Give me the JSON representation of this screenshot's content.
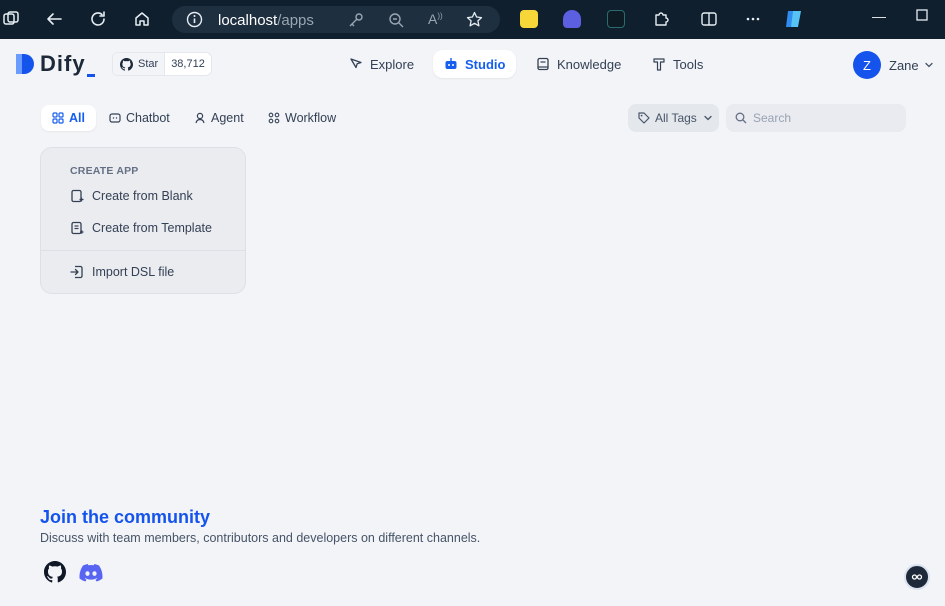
{
  "browser": {
    "url_host": "localhost",
    "url_path": "/apps"
  },
  "header": {
    "logo_text": "Dify",
    "github_star_label": "Star",
    "github_star_count": "38,712",
    "nav": [
      {
        "label": "Explore",
        "icon": "compass-icon"
      },
      {
        "label": "Studio",
        "icon": "robot-icon",
        "active": true
      },
      {
        "label": "Knowledge",
        "icon": "book-icon"
      },
      {
        "label": "Tools",
        "icon": "tool-icon"
      }
    ],
    "user_initial": "Z",
    "user_name": "Zane"
  },
  "tabs": [
    {
      "label": "All",
      "icon": "grid-icon",
      "active": true
    },
    {
      "label": "Chatbot",
      "icon": "chat-icon"
    },
    {
      "label": "Agent",
      "icon": "agent-icon"
    },
    {
      "label": "Workflow",
      "icon": "workflow-icon"
    }
  ],
  "filters": {
    "tags_label": "All Tags",
    "search_placeholder": "Search"
  },
  "create_card": {
    "title": "CREATE APP",
    "create_blank": "Create from Blank",
    "create_template": "Create from Template",
    "import_dsl": "Import DSL file"
  },
  "community": {
    "title": "Join the community",
    "description": "Discuss with team members, contributors and developers on different channels."
  },
  "colors": {
    "accent": "#155eef",
    "background": "#f2f4f7",
    "browser_bar": "#0f1f2e"
  }
}
